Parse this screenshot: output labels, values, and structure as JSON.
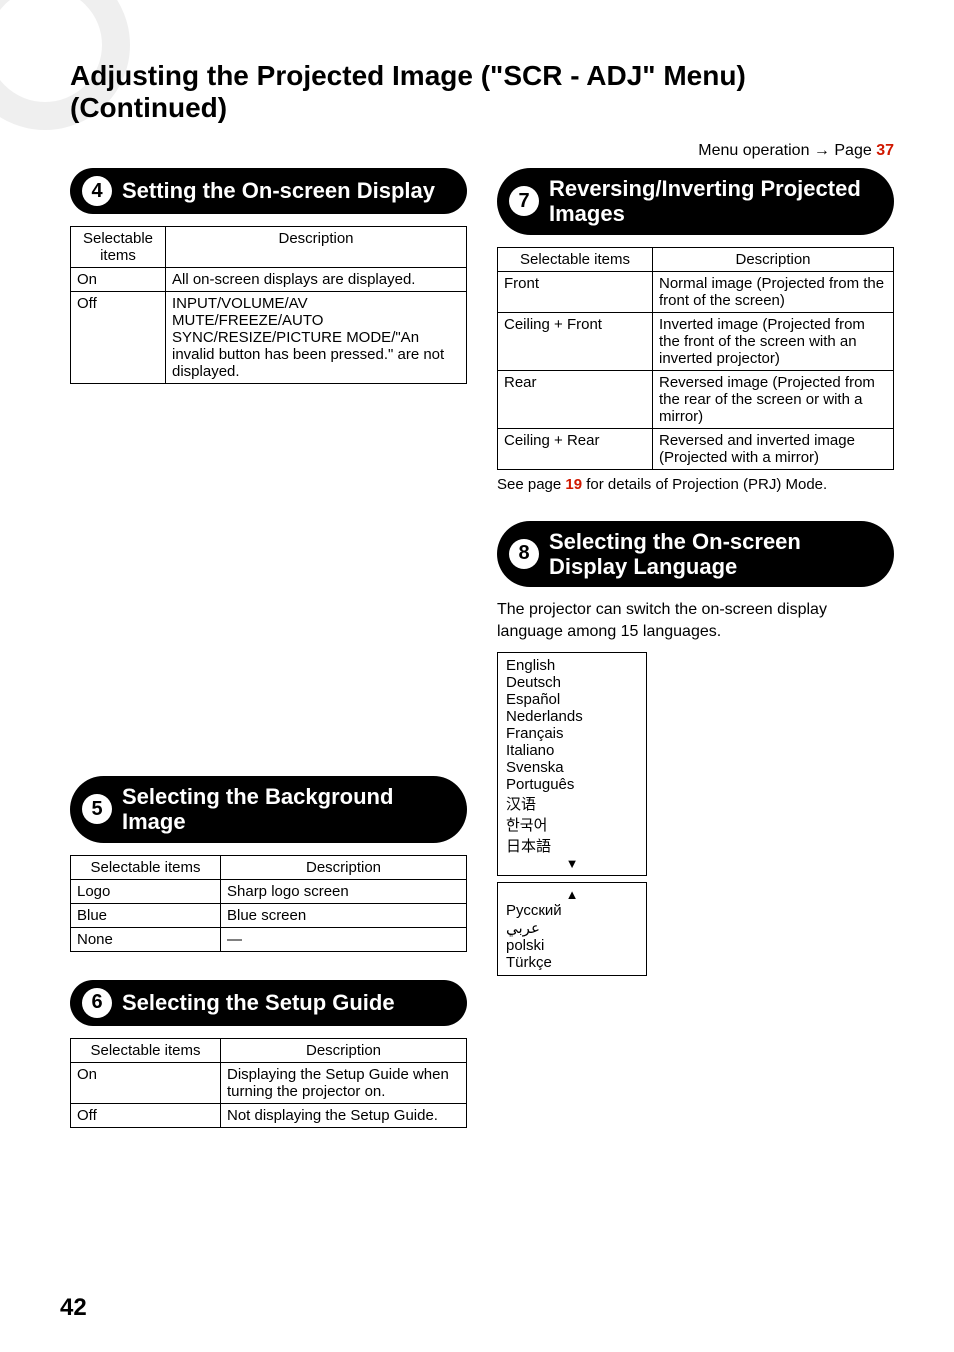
{
  "pageTitle": "Adjusting the Projected Image (\"SCR - ADJ\" Menu) (Continued)",
  "menuOperation": {
    "label": "Menu operation",
    "arrow": "→",
    "pageWord": "Page",
    "pageRef": "37"
  },
  "pageNumber": "42",
  "sections": {
    "s4": {
      "num": "4",
      "title": "Setting the On-screen Display",
      "headers": {
        "c1": "Selectable items",
        "c2": "Description"
      },
      "rows": [
        {
          "c1": "On",
          "c2": "All on-screen displays are displayed."
        },
        {
          "c1": "Off",
          "c2": "INPUT/VOLUME/AV MUTE/FREEZE/AUTO SYNC/RESIZE/PICTURE MODE/\"An invalid button has been pressed.\" are not displayed."
        }
      ]
    },
    "s5": {
      "num": "5",
      "title": "Selecting the Background Image",
      "headers": {
        "c1": "Selectable items",
        "c2": "Description"
      },
      "rows": [
        {
          "c1": "Logo",
          "c2": "Sharp logo screen"
        },
        {
          "c1": "Blue",
          "c2": "Blue screen"
        },
        {
          "c1": "None",
          "c2": "—"
        }
      ]
    },
    "s6": {
      "num": "6",
      "title": "Selecting the Setup Guide",
      "headers": {
        "c1": "Selectable items",
        "c2": "Description"
      },
      "rows": [
        {
          "c1": "On",
          "c2": "Displaying the Setup Guide when turning the projector on."
        },
        {
          "c1": "Off",
          "c2": "Not displaying the Setup Guide."
        }
      ]
    },
    "s7": {
      "num": "7",
      "title": "Reversing/Inverting Projected Images",
      "headers": {
        "c1": "Selectable items",
        "c2": "Description"
      },
      "rows": [
        {
          "c1": "Front",
          "c2": "Normal image (Projected from the front of the screen)"
        },
        {
          "c1": "Ceiling + Front",
          "c2": "Inverted image (Projected from the front of the screen with an inverted projector)"
        },
        {
          "c1": "Rear",
          "c2": "Reversed image (Projected from the rear of the screen or with a mirror)"
        },
        {
          "c1": "Ceiling + Rear",
          "c2": "Reversed and inverted image (Projected with a mirror)"
        }
      ],
      "note": {
        "pre": "See page ",
        "pageRef": "19",
        "post": " for details of Projection (PRJ) Mode."
      }
    },
    "s8": {
      "num": "8",
      "title": "Selecting the On-screen Display Language",
      "blurb": "The projector can switch the on-screen display language among 15 languages.",
      "langBox1": {
        "items": [
          "English",
          "Deutsch",
          "Español",
          "Nederlands",
          "Français",
          "Italiano",
          "Svenska",
          "Português",
          "汉语",
          "한국어",
          "日本語"
        ],
        "triDown": "▼"
      },
      "langBox2": {
        "triUp": "▲",
        "items": [
          "Русский",
          "عربي",
          "polski",
          "Türkçe"
        ]
      }
    }
  }
}
